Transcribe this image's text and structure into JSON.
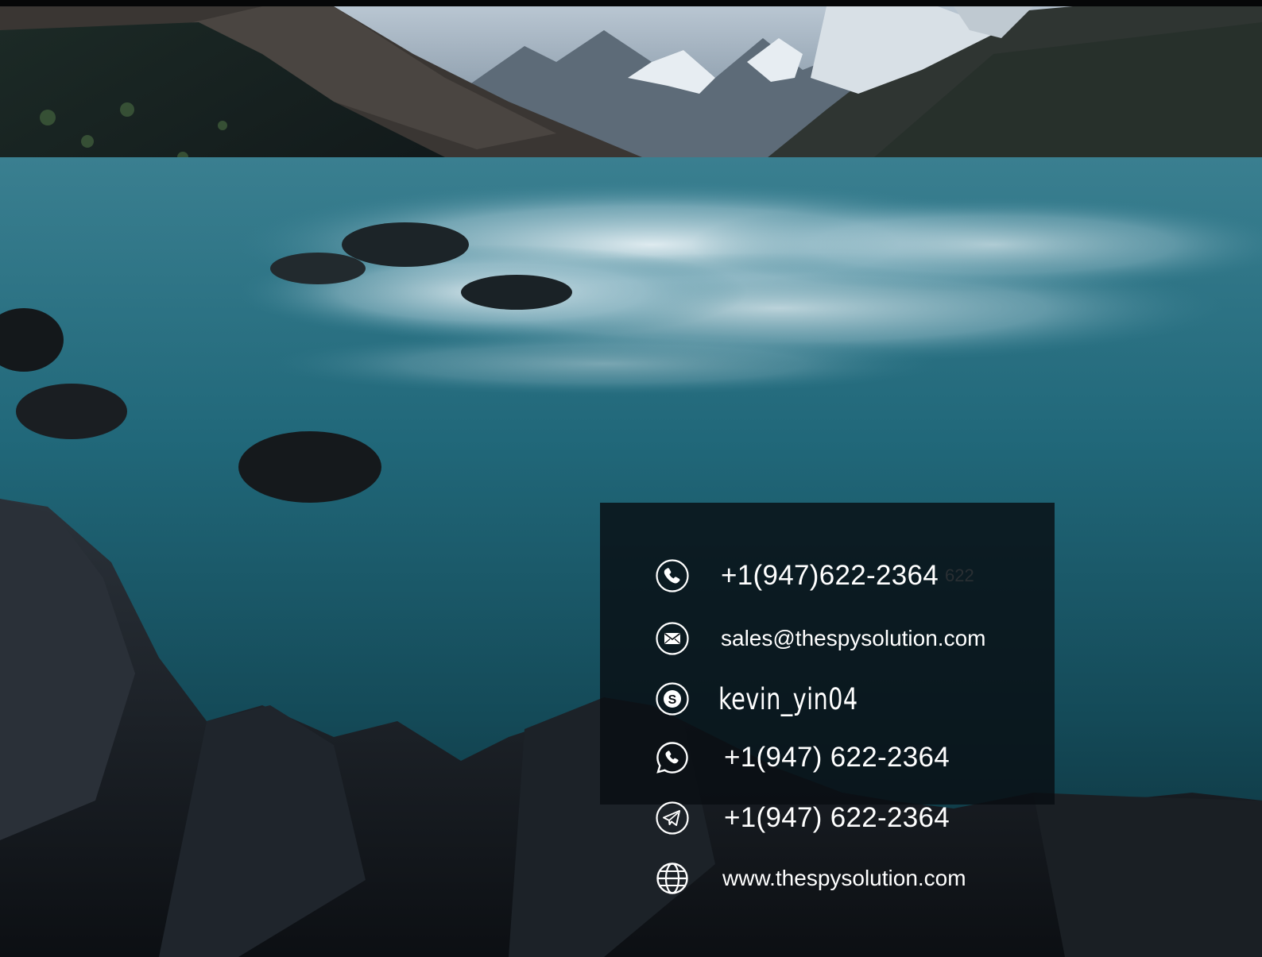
{
  "contact": {
    "phone": {
      "icon": "phone-icon",
      "value": "+1(947)622-2364",
      "ghost": "622"
    },
    "email": {
      "icon": "mail-icon",
      "value": "sales@thespysolution.com"
    },
    "skype": {
      "icon": "skype-icon",
      "value": "kevin_yin04"
    },
    "whatsapp": {
      "icon": "whatsapp-icon",
      "value": "+1(947) 622-2364"
    },
    "telegram": {
      "icon": "telegram-icon",
      "value": "+1(947) 622-2364"
    },
    "website": {
      "icon": "globe-icon",
      "value": "www.thespysolution.com"
    }
  },
  "colors": {
    "panel": "#080e12",
    "text": "#ffffff",
    "water": "#1e5f6e",
    "rock": "#15191f"
  }
}
